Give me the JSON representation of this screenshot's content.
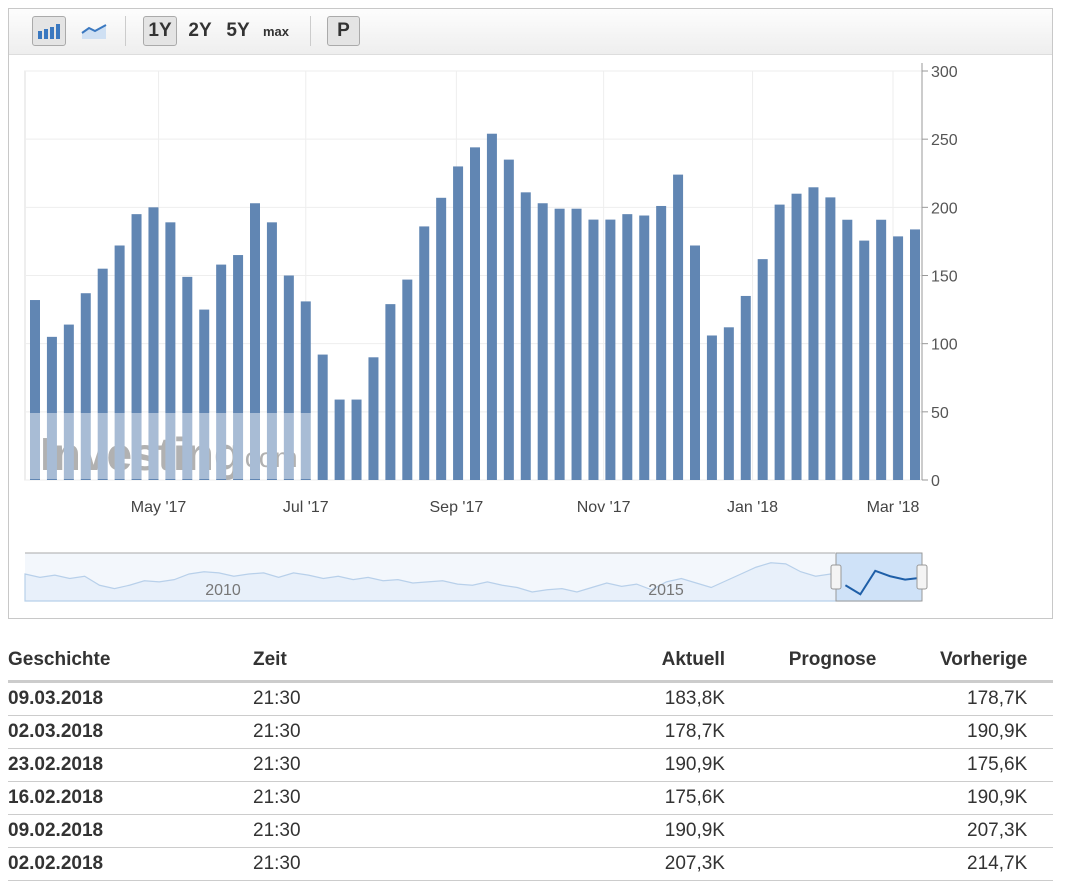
{
  "toolbar": {
    "bar_chart_icon": "bar-chart-icon",
    "line_chart_icon": "line-chart-icon",
    "ranges": [
      "1Y",
      "2Y",
      "5Y",
      "max"
    ],
    "selected_range": "1Y",
    "p_label": "P"
  },
  "watermark": {
    "brand": "Investing",
    "suffix": ".com"
  },
  "chart_data": {
    "type": "bar",
    "title": "",
    "xlabel": "",
    "ylabel": "",
    "ylim": [
      0,
      300
    ],
    "yticks": [
      0,
      50,
      100,
      150,
      200,
      250,
      300
    ],
    "xtick_labels": [
      "May '17",
      "Jul '17",
      "Sep '17",
      "Nov '17",
      "Jan '18",
      "Mar '18"
    ],
    "xtick_bar_index": [
      7.3,
      16,
      24.9,
      33.6,
      42.4,
      50.7
    ],
    "values": [
      132,
      105,
      114,
      137,
      155,
      172,
      195,
      200,
      189,
      149,
      125,
      158,
      165,
      203,
      189,
      150,
      131,
      92,
      59,
      59,
      90,
      129,
      147,
      186,
      207,
      230,
      244,
      254,
      235,
      211,
      203,
      199,
      199,
      191,
      191,
      195,
      194,
      201,
      224,
      172,
      106,
      112,
      135,
      162,
      202,
      210,
      214.7,
      207.3,
      190.9,
      175.6,
      190.9,
      178.7,
      183.8
    ],
    "bar_color": "#6186b3",
    "navigator": {
      "labels": [
        "2010",
        "2015"
      ],
      "values": [
        200,
        185,
        195,
        180,
        190,
        150,
        135,
        150,
        170,
        165,
        175,
        200,
        210,
        205,
        190,
        200,
        205,
        185,
        205,
        195,
        180,
        190,
        175,
        185,
        170,
        175,
        160,
        165,
        170,
        155,
        150,
        165,
        150,
        140,
        120,
        130,
        135,
        120,
        140,
        160,
        145,
        155,
        130,
        165,
        180,
        160,
        140,
        170,
        200,
        230,
        250,
        245,
        210,
        190,
        200,
        150,
        110,
        214,
        190,
        175,
        183
      ]
    }
  },
  "table": {
    "headers": {
      "history": "Geschichte",
      "time": "Zeit",
      "actual": "Aktuell",
      "forecast": "Prognose",
      "previous": "Vorherige"
    },
    "rows": [
      {
        "date": "09.03.2018",
        "time": "21:30",
        "actual": "183,8K",
        "forecast": "",
        "previous": "178,7K"
      },
      {
        "date": "02.03.2018",
        "time": "21:30",
        "actual": "178,7K",
        "forecast": "",
        "previous": "190,9K"
      },
      {
        "date": "23.02.2018",
        "time": "21:30",
        "actual": "190,9K",
        "forecast": "",
        "previous": "175,6K"
      },
      {
        "date": "16.02.2018",
        "time": "21:30",
        "actual": "175,6K",
        "forecast": "",
        "previous": "190,9K"
      },
      {
        "date": "09.02.2018",
        "time": "21:30",
        "actual": "190,9K",
        "forecast": "",
        "previous": "207,3K"
      },
      {
        "date": "02.02.2018",
        "time": "21:30",
        "actual": "207,3K",
        "forecast": "",
        "previous": "214,7K"
      }
    ]
  }
}
